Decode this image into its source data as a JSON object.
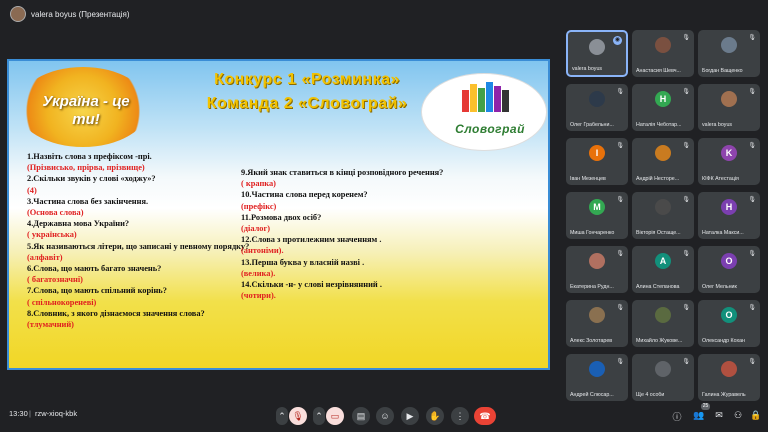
{
  "presenter": {
    "title": "valera boyus (Презентація)"
  },
  "slide": {
    "ukraine_title": "Україна - це ти!",
    "contest_line1": "Конкурс 1 «Розминка»",
    "contest_line2": "Команда 2 «Словограй»",
    "logo_text": "Словограй",
    "left": [
      {
        "q": "1.Назвіть слова з префіксом -прі.",
        "a": "(Прізвисько, прірва, прізвище)"
      },
      {
        "q": "2.Скільки звуків у слові «ходжу»?",
        "a": "(4)"
      },
      {
        "q": "3.Частина слова без закінчення.",
        "a": "(Основа слова)"
      },
      {
        "q": "4.Державна мова України?",
        "a": "( українська)"
      },
      {
        "q": "5.Як називаються літери, що записані у певному порядку?",
        "a": "(алфавіт)"
      },
      {
        "q": "6.Слова, що мають багато значень?",
        "a": "( багатозначні)"
      },
      {
        "q": "7.Слова, що мають спільний корінь?",
        "a": "( спільнокореневі)"
      },
      {
        "q": "8.Словник, з якого дізнаємося значення слова?",
        "a": "(тлумачний)"
      }
    ],
    "right": [
      {
        "q": "9.Який знак ставиться в кінці розповідного речення?",
        "a": "( крапка)"
      },
      {
        "q": "10.Частина слова перед коренем?",
        "a": "(префікс)"
      },
      {
        "q": "11.Розмова двох осіб?",
        "a": "(діалог)"
      },
      {
        "q": "12.Слова з протилежним значенням .",
        "a": "(антоніми)."
      },
      {
        "q": "13.Перша буква у власній назві .",
        "a": "(велика)."
      },
      {
        "q": "14.Скільки -н- у слові незрівнянний .",
        "a": "(чотири)."
      }
    ]
  },
  "participants": [
    {
      "name": "valera boyus",
      "initial": "",
      "color": "#8a8f96",
      "speaking": true
    },
    {
      "name": "Анастасия Шевч...",
      "initial": "",
      "color": "#7a5040"
    },
    {
      "name": "Богдан Ващенко",
      "initial": "",
      "color": "#6b7b8c"
    },
    {
      "name": "Олег Грабельни...",
      "initial": "",
      "color": "#2d3a4a"
    },
    {
      "name": "Наталія Чеботар...",
      "initial": "H",
      "color": "#33a852"
    },
    {
      "name": "valera boyus",
      "initial": "",
      "color": "#a07050"
    },
    {
      "name": "Іван Мезенцев",
      "initial": "I",
      "color": "#e8710a"
    },
    {
      "name": "Андрій Несторе...",
      "initial": "",
      "color": "#c97b20"
    },
    {
      "name": "КІФК Атестація",
      "initial": "K",
      "color": "#8e44ad"
    },
    {
      "name": "Миша Гончаренко",
      "initial": "M",
      "color": "#33a852"
    },
    {
      "name": "Вікторія Остаще...",
      "initial": "",
      "color": "#4a4a4a"
    },
    {
      "name": "Наталка Макси...",
      "initial": "H",
      "color": "#7b3fb0"
    },
    {
      "name": "Екатерина Рудн...",
      "initial": "",
      "color": "#b07060"
    },
    {
      "name": "Алина Степанова",
      "initial": "A",
      "color": "#12907b"
    },
    {
      "name": "Олег Мельник",
      "initial": "O",
      "color": "#7b3fb0"
    },
    {
      "name": "Алекс Золотарев",
      "initial": "",
      "color": "#8a7050"
    },
    {
      "name": "Михайло Жукове...",
      "initial": "",
      "color": "#5a6a40"
    },
    {
      "name": "Олександр Кохан",
      "initial": "O",
      "color": "#12907b"
    },
    {
      "name": "Андрей Слюсар...",
      "initial": "",
      "color": "#1a5fb4"
    },
    {
      "name": "Ще 4 особи",
      "initial": "",
      "color": "#5f6368"
    },
    {
      "name": "Галина Журавель",
      "initial": "",
      "color": "#b05040"
    }
  ],
  "bottom": {
    "time": "13:30",
    "meeting_code": "rzw-xioq-kbk",
    "people_count": "25"
  }
}
